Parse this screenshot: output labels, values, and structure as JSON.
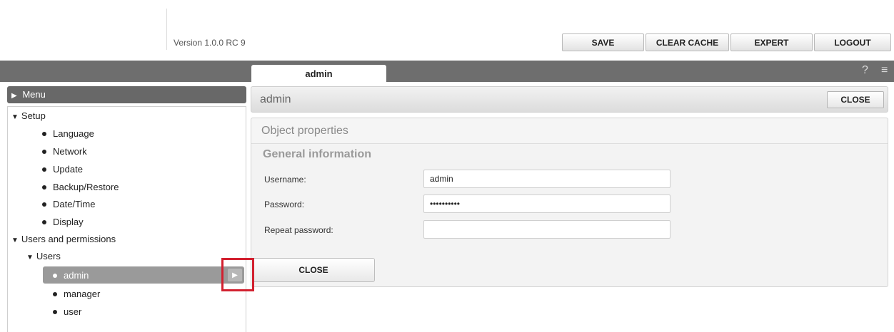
{
  "header": {
    "version": "Version 1.0.0 RC 9",
    "buttons": {
      "save": "SAVE",
      "clear_cache": "CLEAR CACHE",
      "expert": "EXPERT",
      "logout": "LOGOUT"
    }
  },
  "toolbar": {
    "active_tab": "admin",
    "help_icon": "?",
    "menu_icon": "≡"
  },
  "sidebar": {
    "menu_label": "Menu",
    "setup": {
      "label": "Setup",
      "items": [
        "Language",
        "Network",
        "Update",
        "Backup/Restore",
        "Date/Time",
        "Display"
      ]
    },
    "users_permissions": {
      "label": "Users and permissions",
      "users_label": "Users",
      "users": [
        "admin",
        "manager",
        "user"
      ],
      "selected": "admin"
    }
  },
  "main": {
    "title": "admin",
    "close_label": "CLOSE",
    "panel_title": "Object properties",
    "section_title": "General information",
    "fields": {
      "username_label": "Username:",
      "username_value": "admin",
      "password_label": "Password:",
      "password_value": "••••••••••",
      "repeat_label": "Repeat password:",
      "repeat_value": ""
    },
    "bottom_close_label": "CLOSE"
  },
  "colors": {
    "dark_bar": "#6e6e6e",
    "selected_row": "#9a9a9a",
    "highlight": "#d2202f"
  }
}
